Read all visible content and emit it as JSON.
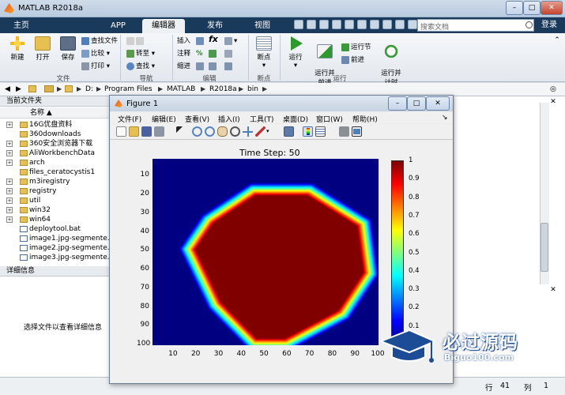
{
  "window": {
    "title": "MATLAB R2018a"
  },
  "ribbon_tabs": [
    "主页",
    "APP",
    "编辑器",
    "发布",
    "视图"
  ],
  "search": {
    "placeholder": "搜索文档"
  },
  "login": "登录",
  "ribbon": {
    "file": {
      "new": "新建",
      "open": "打开",
      "save": "保存",
      "find_files": "查找文件",
      "compare": "比较",
      "print": "打印",
      "group": "文件"
    },
    "navigate": {
      "goto": "转至",
      "find": "查找",
      "group": "导航"
    },
    "edit": {
      "insert": "插入",
      "comment": "注释",
      "indent": "缩进",
      "fx": "fx",
      "group": "编辑"
    },
    "breakpoints": {
      "label": "断点",
      "group": "断点"
    },
    "run": {
      "run": "运行",
      "run_advance": "运行并\n前进",
      "run_section": "运行节",
      "advance": "前进",
      "run_time": "运行并\n计时",
      "group": "运行"
    }
  },
  "address": {
    "drive": "D:",
    "path": [
      "Program Files",
      "MATLAB",
      "R2018a",
      "bin"
    ]
  },
  "current_folder": {
    "title": "当前文件夹",
    "col_name": "名称",
    "items": [
      {
        "name": "16G优盘资料",
        "type": "folder",
        "exp": true
      },
      {
        "name": "360downloads",
        "type": "folder",
        "exp": false
      },
      {
        "name": "360安全浏览器下载",
        "type": "folder",
        "exp": true
      },
      {
        "name": "AliWorkbenchData",
        "type": "folder",
        "exp": true
      },
      {
        "name": "arch",
        "type": "folder",
        "exp": true
      },
      {
        "name": "files_ceratocystis1",
        "type": "folder",
        "exp": false
      },
      {
        "name": "m3iregistry",
        "type": "folder",
        "exp": true
      },
      {
        "name": "registry",
        "type": "folder",
        "exp": true
      },
      {
        "name": "util",
        "type": "folder",
        "exp": true
      },
      {
        "name": "win32",
        "type": "folder",
        "exp": true
      },
      {
        "name": "win64",
        "type": "folder",
        "exp": true
      },
      {
        "name": "deploytool.bat",
        "type": "file",
        "exp": false
      },
      {
        "name": "image1.jpg-segmente...",
        "type": "file",
        "exp": false
      },
      {
        "name": "image2.jpg-segmente...",
        "type": "file",
        "exp": false
      },
      {
        "name": "image3.jpg-segmente...",
        "type": "file",
        "exp": false
      }
    ]
  },
  "details": {
    "title": "详细信息",
    "hint": "选择文件以查看详细信息"
  },
  "status": {
    "row_label": "行",
    "row": "41",
    "col_label": "列",
    "col": "1"
  },
  "figure": {
    "title": "Figure 1",
    "menu": [
      "文件(F)",
      "编辑(E)",
      "查看(V)",
      "插入(I)",
      "工具(T)",
      "桌面(D)",
      "窗口(W)",
      "帮助(H)"
    ]
  },
  "chart_data": {
    "type": "heatmap",
    "title": "Time Step: 50",
    "x_ticks": [
      10,
      20,
      30,
      40,
      50,
      60,
      70,
      80,
      90,
      100
    ],
    "y_ticks": [
      10,
      20,
      30,
      40,
      50,
      60,
      70,
      80,
      90,
      100
    ],
    "xlim": [
      1,
      100
    ],
    "ylim": [
      1,
      100
    ],
    "y_reversed": true,
    "region_value": 1,
    "background_value": 0,
    "region_polygon": [
      [
        45,
        17
      ],
      [
        70,
        17
      ],
      [
        94,
        35
      ],
      [
        97,
        62
      ],
      [
        85,
        84
      ],
      [
        60,
        100
      ],
      [
        45,
        100
      ],
      [
        28,
        79
      ],
      [
        16,
        49
      ],
      [
        25,
        33
      ]
    ],
    "colormap": "jet",
    "colorbar_ticks": [
      0.1,
      0.2,
      0.3,
      0.4,
      0.5,
      0.6,
      0.7,
      0.8,
      0.9,
      1
    ],
    "clim": [
      0,
      1
    ]
  },
  "watermark": {
    "text": "必过源码",
    "sub": "Biguo100.com"
  },
  "colors": {
    "ribbon_dark": "#1a3a5c",
    "accent": "#3a67a8"
  }
}
